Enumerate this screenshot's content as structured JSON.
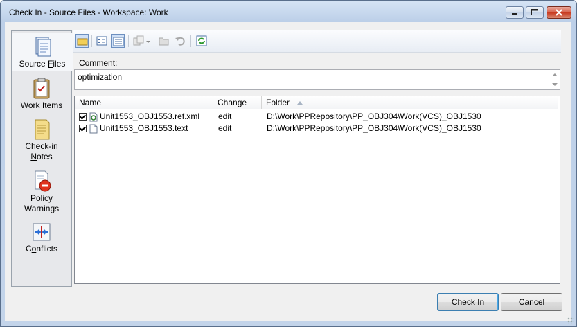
{
  "window": {
    "title": "Check In - Source Files - Workspace: Work",
    "controls": [
      "minimize",
      "maximize",
      "close"
    ]
  },
  "sidebar": {
    "items": [
      {
        "label_pre": "Source ",
        "label_u": "F",
        "label_post": "iles",
        "icon": "source-files-icon",
        "selected": true
      },
      {
        "label_pre": "",
        "label_u": "W",
        "label_post": "ork Items",
        "icon": "work-items-icon"
      },
      {
        "line1": "Check-in",
        "line2_pre": "",
        "line2_u": "N",
        "line2_post": "otes",
        "icon": "checkin-notes-icon"
      },
      {
        "line1_pre": "",
        "line1_u": "P",
        "line1_post": "olicy",
        "line2": "Warnings",
        "icon": "policy-warnings-icon"
      },
      {
        "label_pre": "C",
        "label_u": "o",
        "label_post": "nflicts",
        "icon": "conflicts-icon"
      }
    ]
  },
  "toolbar": {
    "icons": [
      "tag-icon",
      "list-view-icon",
      "details-view-icon",
      "compare-icon",
      "dropdown-arrow-icon",
      "open-folder-icon",
      "undo-icon",
      "refresh-icon"
    ]
  },
  "comment": {
    "label_pre": "Co",
    "label_u": "m",
    "label_post": "ment:",
    "value": "optimization"
  },
  "file_list": {
    "columns": [
      "Name",
      "Change",
      "Folder"
    ],
    "sorted_column": "Folder",
    "rows": [
      {
        "checked": true,
        "name": "Unit1553_OBJ1553.ref.xml",
        "change": "edit",
        "folder": "D:\\Work\\PPRepository\\PP_OBJ304\\Work(VCS)_OBJ1530",
        "icon": "xml-file-icon"
      },
      {
        "checked": true,
        "name": "Unit1553_OBJ1553.text",
        "change": "edit",
        "folder": "D:\\Work\\PPRepository\\PP_OBJ304\\Work(VCS)_OBJ1530",
        "icon": "text-file-icon"
      }
    ]
  },
  "buttons": {
    "checkin_pre": "",
    "checkin_u": "C",
    "checkin_post": "heck In",
    "cancel": "Cancel"
  }
}
